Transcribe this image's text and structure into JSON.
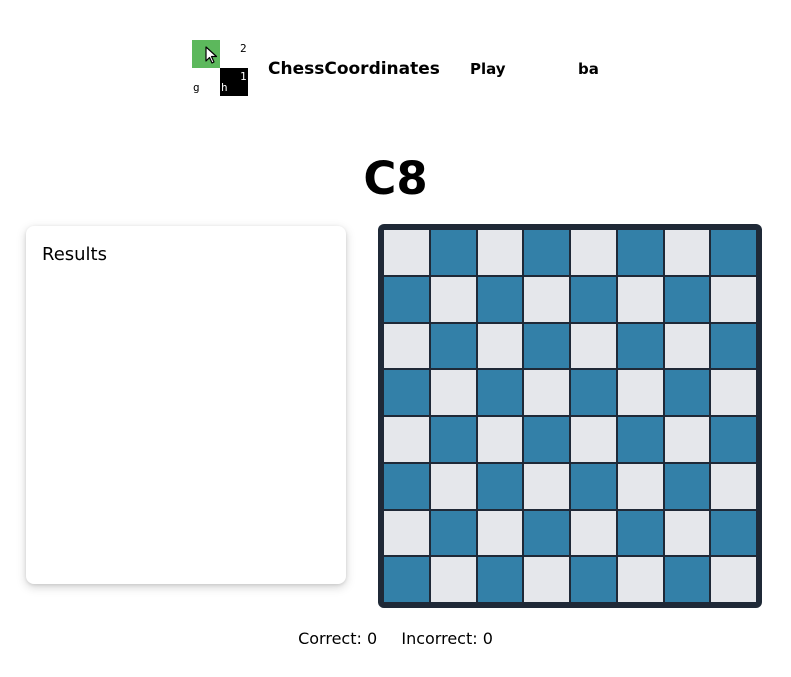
{
  "header": {
    "logo_labels": {
      "top_right": "2",
      "mid_right": "1",
      "bottom_left": "g",
      "bottom_mid": "h"
    },
    "brand": "ChessCoordinates",
    "nav_play": "Play",
    "nav_lang": "ba"
  },
  "target_coordinate": "C8",
  "results": {
    "title": "Results"
  },
  "board": {
    "size": 8,
    "light_color": "#e5e7eb",
    "dark_color": "#3380a8",
    "frame_color": "#1f2937"
  },
  "score": {
    "correct_label": "Correct:",
    "correct": "0",
    "incorrect_label": "Incorrect:",
    "incorrect": "0"
  },
  "colors": {
    "logo_green": "#5cb85c"
  }
}
